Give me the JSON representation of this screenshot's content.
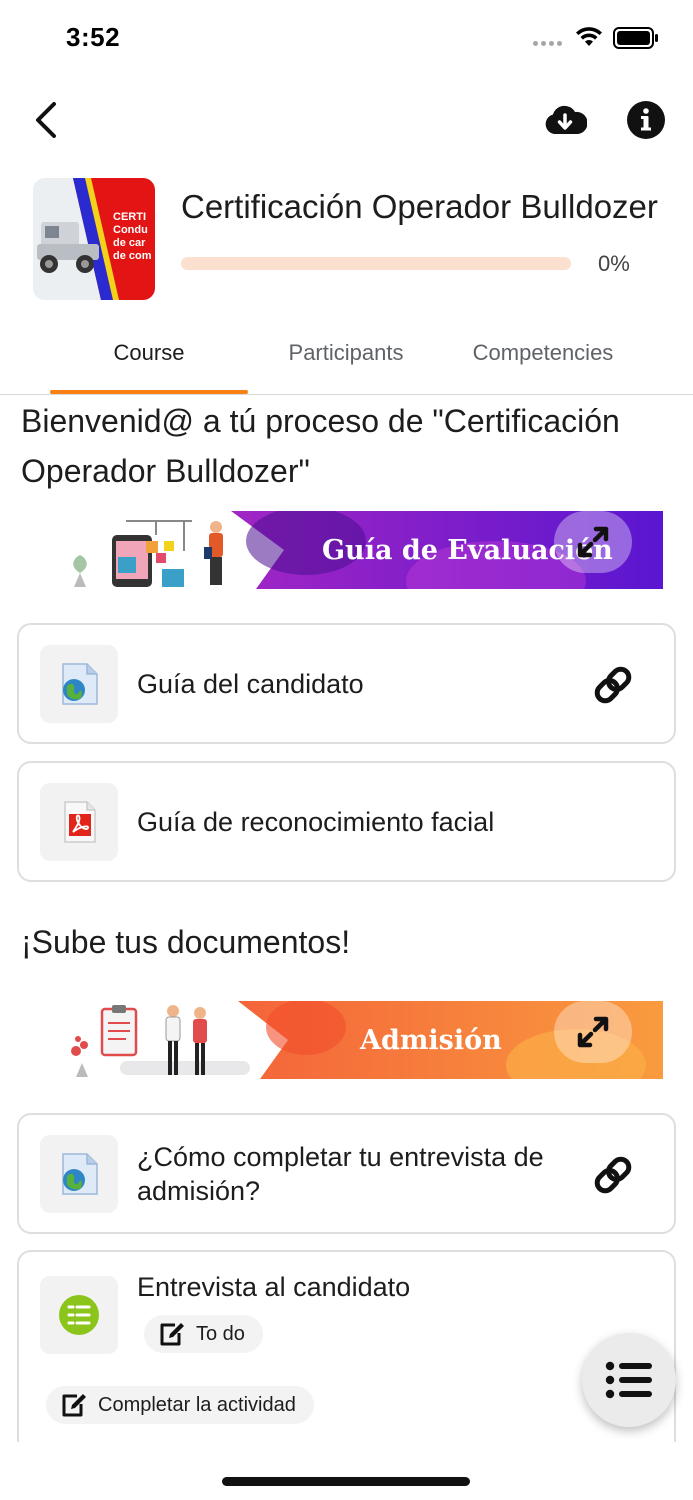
{
  "status_bar": {
    "time": "3:52"
  },
  "nav": {
    "back_icon": "chevron-left-icon",
    "download_icon": "cloud-download-icon",
    "info_icon": "info-icon"
  },
  "course": {
    "title": "Certificación Operador Bulldozer",
    "progress_label": "0%",
    "progress_value": 0,
    "thumbnail_text": [
      "CERTI",
      "Condu",
      "de car",
      "de com"
    ]
  },
  "tabs": [
    {
      "label": "Course",
      "active": true
    },
    {
      "label": "Participants",
      "active": false
    },
    {
      "label": "Competencies",
      "active": false
    }
  ],
  "sections": [
    {
      "title": "Bienvenid@ a tú proceso de \"Certificación Operador Bulldozer\"",
      "banner_text": "Guía de Evaluación",
      "items": [
        {
          "label": "Guía del candidato",
          "icon": "web-document-icon",
          "action_icon": "link-icon"
        },
        {
          "label": "Guía de reconocimiento facial",
          "icon": "pdf-icon"
        }
      ]
    },
    {
      "title": "¡Sube tus documentos!",
      "banner_text": "Admisión",
      "items": [
        {
          "label": "¿Cómo completar tu entrevista de admisión?",
          "icon": "web-document-icon",
          "action_icon": "link-icon"
        },
        {
          "label": "Entrevista al candidato",
          "icon": "feedback-icon",
          "status": "To do",
          "completion": "Completar la actividad"
        }
      ]
    }
  ],
  "fab": {
    "icon": "list-icon"
  },
  "colors": {
    "accent": "#f98012",
    "progress_track": "#fbe0cf",
    "banner_purple": "#7b1fd0",
    "banner_orange": "#f7893a"
  }
}
